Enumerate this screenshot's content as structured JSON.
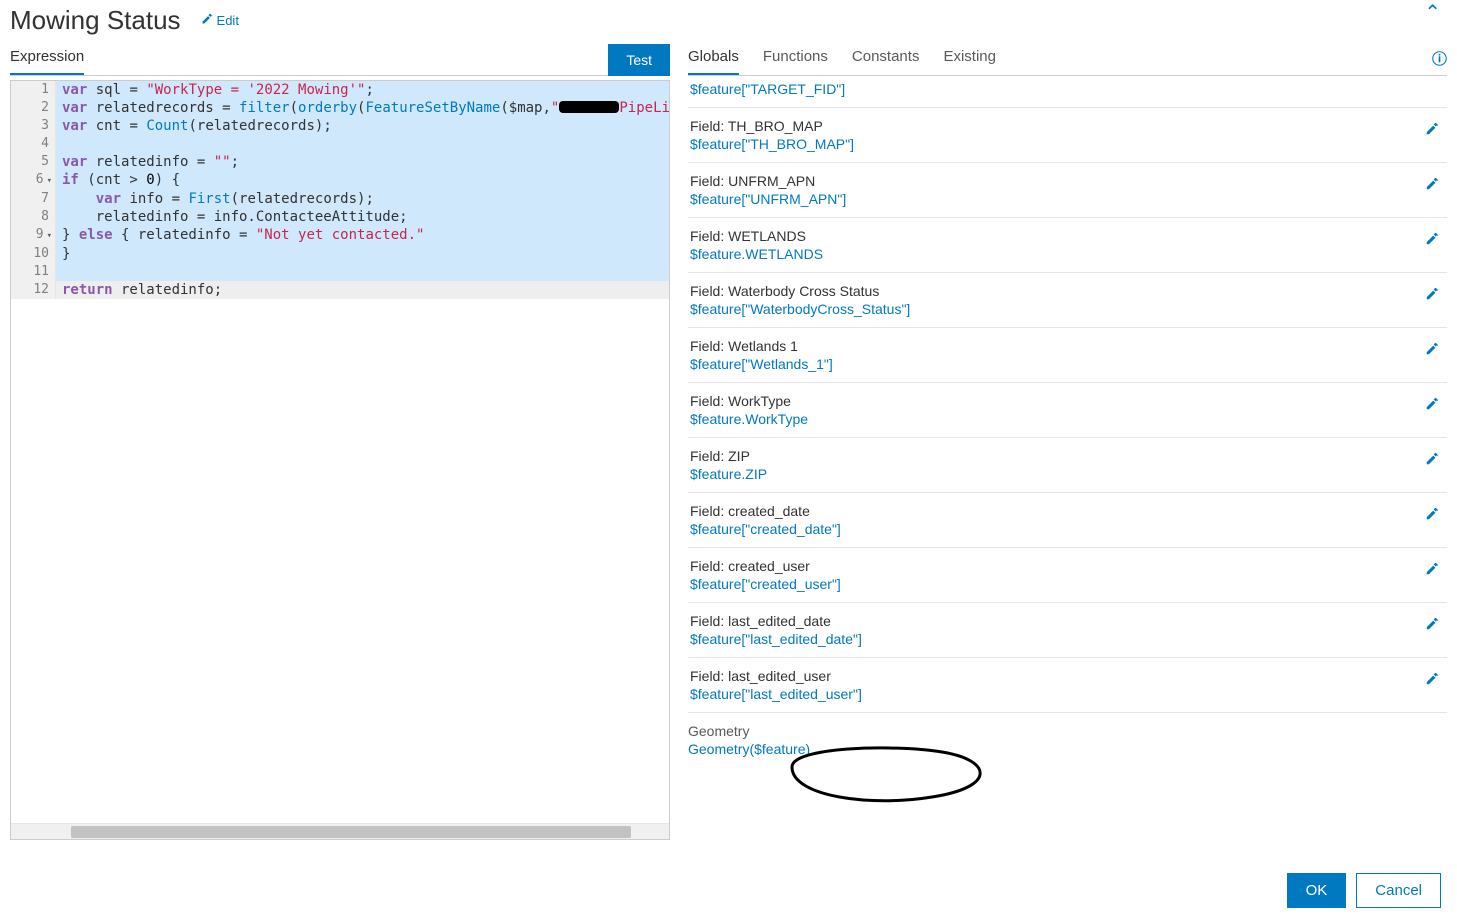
{
  "title": "Mowing Status",
  "edit_label": "Edit",
  "left": {
    "tab_expression": "Expression",
    "test_button": "Test"
  },
  "code": {
    "lines": [
      "var sql = \"WorkType = '2022 Mowing'\";",
      "var relatedrecords = filter(orderby(FeatureSetByName($map,\"██████PipeLi",
      "var cnt = Count(relatedrecords);",
      "",
      "var relatedinfo = \"\";",
      "if (cnt > 0) {",
      "    var info = First(relatedrecords);",
      "    relatedinfo = info.ContacteeAttitude;",
      "} else { relatedinfo = \"Not yet contacted.\"",
      "}",
      "",
      "return relatedinfo;"
    ]
  },
  "right": {
    "tabs": {
      "globals": "Globals",
      "functions": "Functions",
      "constants": "Constants",
      "existing": "Existing"
    },
    "truncated_top": "$feature[\"TARGET_FID\"]",
    "fields": [
      {
        "label": "Field: TH_BRO_MAP",
        "code": "$feature[\"TH_BRO_MAP\"]"
      },
      {
        "label": "Field: UNFRM_APN",
        "code": "$feature[\"UNFRM_APN\"]"
      },
      {
        "label": "Field: WETLANDS",
        "code": "$feature.WETLANDS"
      },
      {
        "label": "Field: Waterbody Cross Status",
        "code": "$feature[\"WaterbodyCross_Status\"]"
      },
      {
        "label": "Field: Wetlands 1",
        "code": "$feature[\"Wetlands_1\"]"
      },
      {
        "label": "Field: WorkType",
        "code": "$feature.WorkType"
      },
      {
        "label": "Field: ZIP",
        "code": "$feature.ZIP"
      },
      {
        "label": "Field: created_date",
        "code": "$feature[\"created_date\"]"
      },
      {
        "label": "Field: created_user",
        "code": "$feature[\"created_user\"]"
      },
      {
        "label": "Field: last_edited_date",
        "code": "$feature[\"last_edited_date\"]"
      },
      {
        "label": "Field: last_edited_user",
        "code": "$feature[\"last_edited_user\"]"
      }
    ],
    "geometry_header": "Geometry",
    "geometry_code": "Geometry($feature)"
  },
  "footer": {
    "ok": "OK",
    "cancel": "Cancel"
  }
}
